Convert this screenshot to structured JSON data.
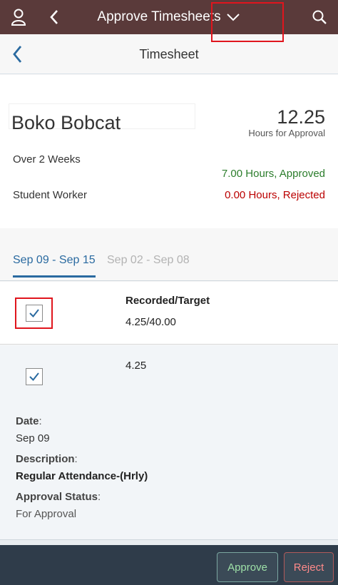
{
  "topbar": {
    "title": "Approve Timesheets",
    "icons": [
      "user-icon",
      "back-icon",
      "chevron-down-icon",
      "search-icon"
    ]
  },
  "subheader": {
    "title": "Timesheet"
  },
  "header": {
    "name": "Boko Bobcat",
    "hours": "12.25",
    "hours_label": "Hours for Approval",
    "period": "Over 2 Weeks",
    "approved": "7.00 Hours, Approved",
    "role": "Student Worker",
    "rejected": "0.00 Hours, Rejected"
  },
  "tabs": [
    {
      "label": "Sep 09 - Sep 15",
      "active": true
    },
    {
      "label": "Sep 02 - Sep 08",
      "active": false
    }
  ],
  "summary_row": {
    "column_header": "Recorded/Target",
    "value": "4.25/40.00",
    "checked": true
  },
  "detail_row": {
    "value": "4.25",
    "checked": true,
    "date_label": "Date",
    "date": "Sep 09",
    "description_label": "Description",
    "description": "Regular Attendance-(Hrly)",
    "status_label": "Approval Status",
    "status": "For Approval",
    "colon": ":"
  },
  "footer": {
    "approve": "Approve",
    "reject": "Reject"
  },
  "colors": {
    "topbar": "#5a3a3a",
    "footer": "#2f3c4a",
    "accent": "#2a6aa0",
    "approved": "#2b7d2b",
    "rejected": "#bb0000",
    "highlight": "#e0151d"
  }
}
